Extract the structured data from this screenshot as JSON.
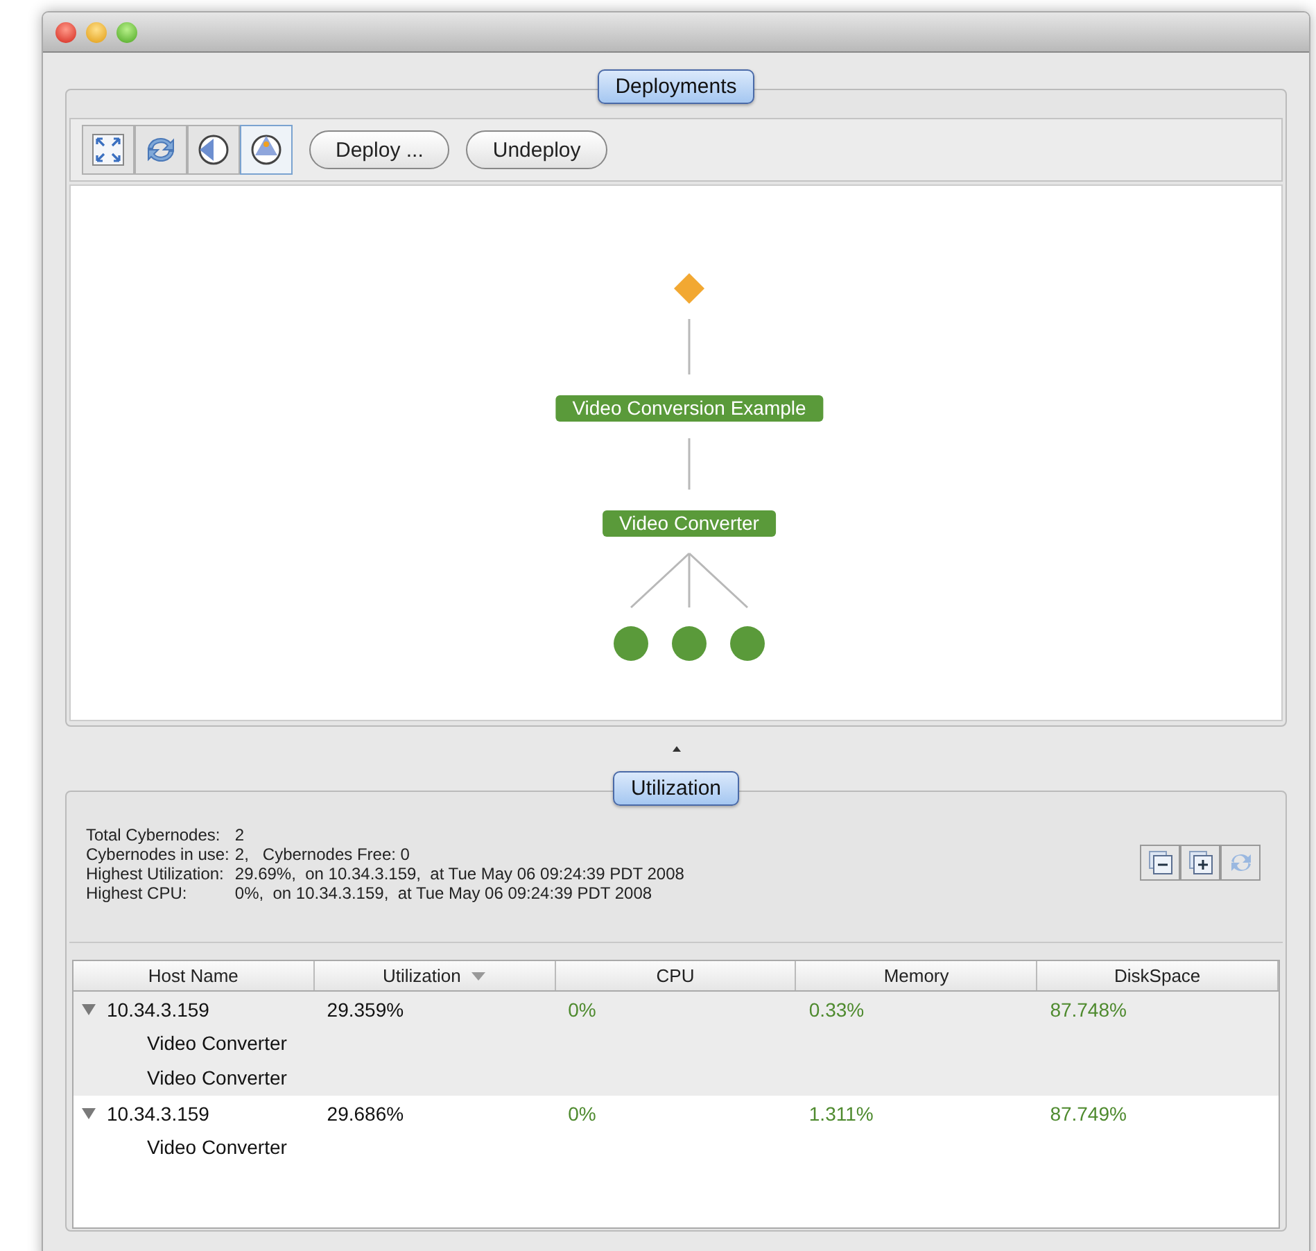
{
  "deployments": {
    "title": "Deployments",
    "tools": [
      {
        "kind": "fit",
        "selected": false
      },
      {
        "kind": "refresh",
        "selected": false
      },
      {
        "kind": "left",
        "selected": false
      },
      {
        "kind": "up",
        "selected": true
      }
    ],
    "buttons": [
      "Deploy ...",
      "Undeploy"
    ],
    "diagram": {
      "kind": "diamond",
      "children": [
        {
          "kind": "label",
          "text": "Video Conversion Example",
          "children": [
            {
              "kind": "label",
              "text": "Video Converter",
              "children": [
                {
                  "kind": "circle"
                },
                {
                  "kind": "circle"
                },
                {
                  "kind": "circle"
                }
              ]
            }
          ]
        }
      ]
    }
  },
  "utilization": {
    "title": "Utilization",
    "summary": [
      {
        "label": "Total Cybernodes:",
        "value": "2"
      },
      {
        "label": "Cybernodes in use:",
        "value": "2,   Cybernodes Free: 0"
      },
      {
        "label": "Highest Utilization:",
        "value": "29.69%,  on 10.34.3.159,  at Tue May 06 09:24:39 PDT 2008"
      },
      {
        "label": "Highest CPU:",
        "value": "0%,  on 10.34.3.159,  at Tue May 06 09:24:39 PDT 2008"
      }
    ],
    "tools": [
      {
        "kind": "collapse"
      },
      {
        "kind": "expand"
      },
      {
        "kind": "refresh"
      }
    ],
    "columns": [
      {
        "label": "Host Name",
        "sorted": false
      },
      {
        "label": "Utilization",
        "sorted": true
      },
      {
        "label": "CPU",
        "sorted": false
      },
      {
        "label": "Memory",
        "sorted": false
      },
      {
        "label": "DiskSpace",
        "sorted": false
      }
    ],
    "rows": [
      {
        "host": "10.34.3.159",
        "utilization": "29.359%",
        "cpu": "0%",
        "memory": "0.33%",
        "disk": "87.748%",
        "expanded": true,
        "selected": true,
        "children": [
          "Video Converter",
          "Video Converter"
        ]
      },
      {
        "host": "10.34.3.159",
        "utilization": "29.686%",
        "cpu": "0%",
        "memory": "1.311%",
        "disk": "87.749%",
        "expanded": true,
        "selected": false,
        "children": [
          "Video Converter"
        ]
      }
    ]
  }
}
